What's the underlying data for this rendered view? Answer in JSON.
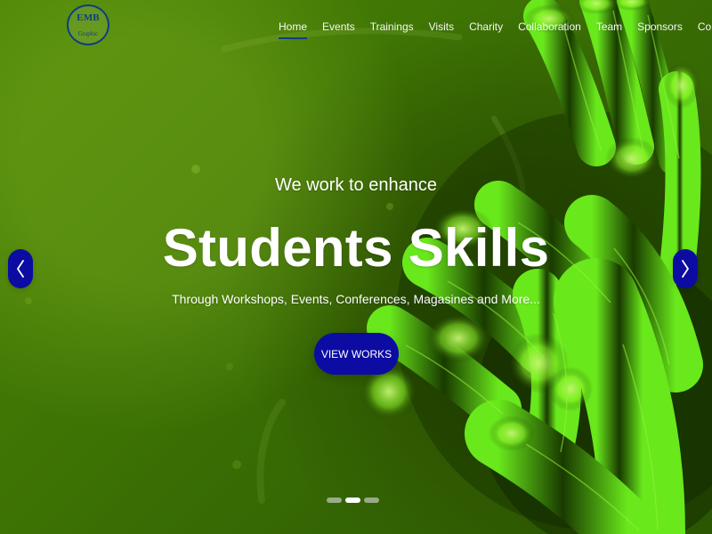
{
  "brand": {
    "logo_text_main": "EMB",
    "logo_text_sub": "Graphic"
  },
  "nav": {
    "items": [
      {
        "label": "Home"
      },
      {
        "label": "Events"
      },
      {
        "label": "Trainings"
      },
      {
        "label": "Visits"
      },
      {
        "label": "Charity"
      },
      {
        "label": "Collaboration"
      },
      {
        "label": "Team"
      },
      {
        "label": "Sponsors"
      },
      {
        "label": "Contact"
      }
    ]
  },
  "hero": {
    "subtitle": "We work to enhance",
    "title": "Students Skills",
    "description": "Through Workshops, Events, Conferences, Magasines and More...",
    "cta_label": "VIEW WORKS"
  },
  "carousel": {
    "active_slide": 2,
    "slide_count": 3
  },
  "icons": {
    "prev": "chevron-left-icon",
    "next": "chevron-right-icon"
  },
  "colors": {
    "accent": "#0c0ca2",
    "logo_blue": "#0f3d88",
    "hero_green": "#4f8b05"
  }
}
